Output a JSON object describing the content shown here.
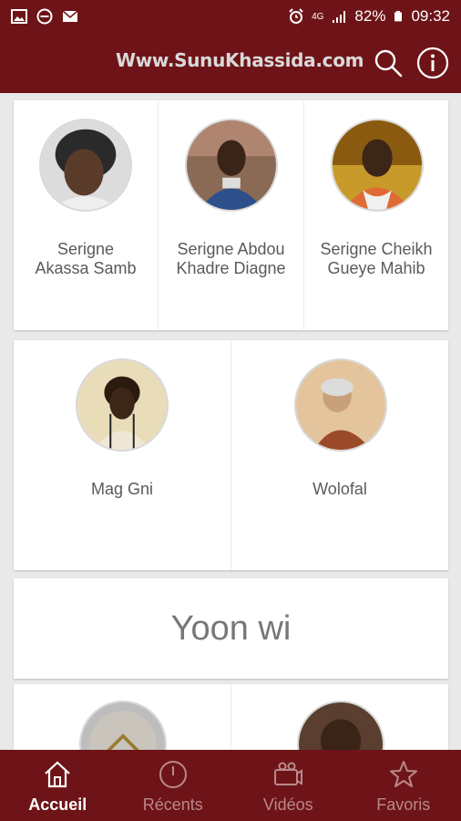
{
  "status_bar": {
    "battery": "82%",
    "time": "09:32",
    "network": "4G",
    "icons": [
      "image-icon",
      "do-not-disturb-icon",
      "mail-icon",
      "alarm-icon",
      "signal-icon",
      "battery-icon"
    ]
  },
  "header": {
    "title": "Www.SunuKhassida.com",
    "icons": [
      "search-icon",
      "info-icon"
    ]
  },
  "grid_row_1": [
    {
      "name": "Serigne Akassa Samb"
    },
    {
      "name": "Serigne Abdou Khadre Diagne"
    },
    {
      "name": "Serigne Cheikh Gueye Mahib"
    }
  ],
  "grid_row_2": [
    {
      "name": "Mag Gni"
    },
    {
      "name": "Wolofal"
    }
  ],
  "section": {
    "title": "Yoon wi"
  },
  "bottom_nav": [
    {
      "label": "Accueil",
      "icon": "home-icon",
      "active": true
    },
    {
      "label": "Récents",
      "icon": "clock-icon",
      "active": false
    },
    {
      "label": "Vidéos",
      "icon": "video-icon",
      "active": false
    },
    {
      "label": "Favoris",
      "icon": "star-icon",
      "active": false
    }
  ],
  "colors": {
    "primary": "#6e1418",
    "background": "#e9e9e9",
    "card": "#ffffff",
    "text": "#5a5a5a",
    "nav_inactive": "#b9888b"
  }
}
